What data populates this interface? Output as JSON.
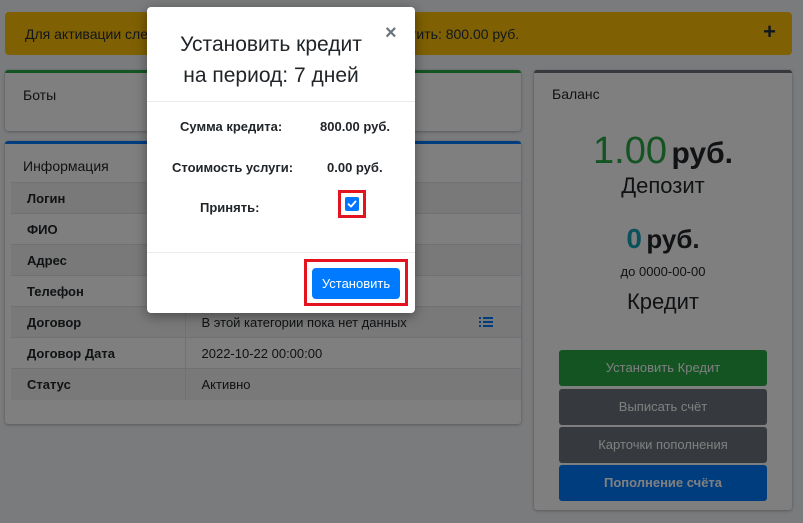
{
  "alert": {
    "text_left": "Для активации сле",
    "text_right": "тить: 800.00 руб.",
    "plus": "+"
  },
  "bots": {
    "title": "Боты"
  },
  "info": {
    "title": "Информация",
    "rows": [
      {
        "key": "Логин",
        "value": ""
      },
      {
        "key": "ФИО",
        "value": ""
      },
      {
        "key": "Адрес",
        "value": ""
      },
      {
        "key": "Телефон",
        "value": ""
      },
      {
        "key": "Договор",
        "value": "В этой категории пока нет данных"
      },
      {
        "key": "Договор Дата",
        "value": "2022-10-22 00:00:00"
      },
      {
        "key": "Статус",
        "value": "Активно"
      }
    ]
  },
  "balance": {
    "title": "Баланс",
    "deposit_amount": "1.00",
    "deposit_currency": "руб.",
    "deposit_label": "Депозит",
    "credit_amount": "0",
    "credit_currency": "руб.",
    "credit_until": "до 0000-00-00",
    "credit_label": "Кредит",
    "buttons": {
      "set_credit": "Установить Кредит",
      "invoice": "Выписать счёт",
      "cards": "Карточки пополнения",
      "topup": "Пополнение счёта"
    }
  },
  "modal": {
    "title_line1": "Установить кредит",
    "title_line2": "на период: 7 дней",
    "close": "×",
    "credit_sum_label": "Сумма кредита:",
    "credit_sum_value": "800.00 руб.",
    "service_cost_label": "Стоимость услуги:",
    "service_cost_value": "0.00 руб.",
    "accept_label": "Принять:",
    "accept_checked": true,
    "submit_label": "Установить"
  },
  "colors": {
    "alert": "#ffc107",
    "deposit_green": "#28a745",
    "credit_blue": "#17a2b8",
    "primary": "#007bff",
    "highlight_red": "#e3141f"
  }
}
